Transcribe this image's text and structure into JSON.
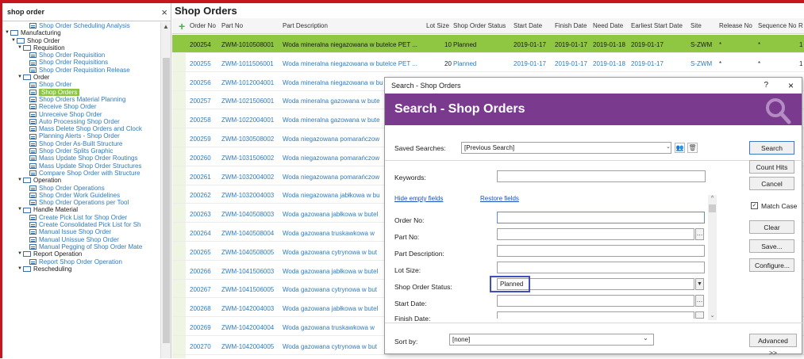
{
  "nav": {
    "search_value": "shop order",
    "tree": [
      {
        "label": "Shop Order Scheduling Analysis",
        "kind": "link",
        "indent": 3,
        "twisty": ""
      },
      {
        "label": "Manufacturing",
        "kind": "folder",
        "indent": 0,
        "twisty": "▼"
      },
      {
        "label": "Shop Order",
        "kind": "folder",
        "indent": 1,
        "twisty": "▼"
      },
      {
        "label": "Requisition",
        "kind": "folder",
        "indent": 2,
        "twisty": "▼"
      },
      {
        "label": "Shop Order Requisition",
        "kind": "link",
        "indent": 3,
        "twisty": ""
      },
      {
        "label": "Shop Order Requisitions",
        "kind": "link",
        "indent": 3,
        "twisty": ""
      },
      {
        "label": "Shop Order Requisition Release",
        "kind": "link",
        "indent": 3,
        "twisty": ""
      },
      {
        "label": "Order",
        "kind": "folder",
        "indent": 2,
        "twisty": "▼"
      },
      {
        "label": "Shop Order",
        "kind": "link",
        "indent": 3,
        "twisty": ""
      },
      {
        "label": "Shop Orders",
        "kind": "link",
        "indent": 3,
        "twisty": "",
        "selected": true
      },
      {
        "label": "Shop Orders Material Planning",
        "kind": "link",
        "indent": 3,
        "twisty": ""
      },
      {
        "label": "Receive Shop Order",
        "kind": "link",
        "indent": 3,
        "twisty": ""
      },
      {
        "label": "Unreceive Shop Order",
        "kind": "link",
        "indent": 3,
        "twisty": ""
      },
      {
        "label": "Auto Processing Shop Order",
        "kind": "link",
        "indent": 3,
        "twisty": ""
      },
      {
        "label": "Mass Delete Shop Orders and Clock",
        "kind": "link",
        "indent": 3,
        "twisty": ""
      },
      {
        "label": "Planning Alerts - Shop Order",
        "kind": "link",
        "indent": 3,
        "twisty": ""
      },
      {
        "label": "Shop Order As-Built Structure",
        "kind": "link",
        "indent": 3,
        "twisty": ""
      },
      {
        "label": "Shop Order Splits Graphic",
        "kind": "link",
        "indent": 3,
        "twisty": ""
      },
      {
        "label": "Mass Update Shop Order Routings",
        "kind": "link",
        "indent": 3,
        "twisty": ""
      },
      {
        "label": "Mass Update Shop Order Structures",
        "kind": "link",
        "indent": 3,
        "twisty": ""
      },
      {
        "label": "Compare Shop Order with Structure",
        "kind": "link",
        "indent": 3,
        "twisty": ""
      },
      {
        "label": "Operation",
        "kind": "folder",
        "indent": 2,
        "twisty": "▼"
      },
      {
        "label": "Shop Order Operations",
        "kind": "link",
        "indent": 3,
        "twisty": ""
      },
      {
        "label": "Shop Order Work Guidelines",
        "kind": "link",
        "indent": 3,
        "twisty": ""
      },
      {
        "label": "Shop Order Operations per Tool",
        "kind": "link",
        "indent": 3,
        "twisty": ""
      },
      {
        "label": "Handle Material",
        "kind": "folder",
        "indent": 2,
        "twisty": "▼"
      },
      {
        "label": "Create Pick List for Shop Order",
        "kind": "link",
        "indent": 3,
        "twisty": ""
      },
      {
        "label": "Create Consolidated Pick List for Sh",
        "kind": "link",
        "indent": 3,
        "twisty": ""
      },
      {
        "label": "Manual Issue Shop Order",
        "kind": "link",
        "indent": 3,
        "twisty": ""
      },
      {
        "label": "Manual Unissue Shop Order",
        "kind": "link",
        "indent": 3,
        "twisty": ""
      },
      {
        "label": "Manual Pegging of Shop Order Mate",
        "kind": "link",
        "indent": 3,
        "twisty": ""
      },
      {
        "label": "Report Operation",
        "kind": "folder",
        "indent": 2,
        "twisty": "▼"
      },
      {
        "label": "Report Shop Order Operation",
        "kind": "link",
        "indent": 3,
        "twisty": ""
      },
      {
        "label": "Rescheduling",
        "kind": "folder",
        "indent": 2,
        "twisty": "▼"
      }
    ]
  },
  "main": {
    "title": "Shop Orders",
    "columns": [
      "Order No",
      "Part No",
      "Part Description",
      "Lot Size",
      "Shop Order Status",
      "Start Date",
      "Finish Date",
      "Need Date",
      "Earliest Start Date",
      "Site",
      "Release No",
      "Sequence No",
      "R"
    ],
    "rows": [
      {
        "order": "200254",
        "part": "ZWM-1010508001",
        "desc": "Woda mineralna niegazowana w butelce PET ...",
        "lot": "10",
        "status": "Planned",
        "start": "2019-01-17",
        "finish": "2019-01-17",
        "need": "2019-01-18",
        "earliest": "2019-01-17",
        "site": "S-ZWM",
        "release": "*",
        "sequence": "*",
        "r": "1"
      },
      {
        "order": "200255",
        "part": "ZWM-1011506001",
        "desc": "Woda mineralna niegazowana w butelce PET ...",
        "lot": "20",
        "status": "Planned",
        "start": "2019-01-17",
        "finish": "2019-01-17",
        "need": "2019-01-18",
        "earliest": "2019-01-17",
        "site": "S-ZWM",
        "release": "*",
        "sequence": "*",
        "r": "1"
      },
      {
        "order": "200256",
        "part": "ZWM-1012004001",
        "desc": "Woda mineralna niegazowana w bu"
      },
      {
        "order": "200257",
        "part": "ZWM-1021506001",
        "desc": "Woda mineralna gazowana w bute"
      },
      {
        "order": "200258",
        "part": "ZWM-1022004001",
        "desc": "Woda mineralna gazowana w bute"
      },
      {
        "order": "200259",
        "part": "ZWM-1030508002",
        "desc": "Woda niegazowana pomarańczow"
      },
      {
        "order": "200260",
        "part": "ZWM-1031506002",
        "desc": "Woda niegazowana pomarańczow"
      },
      {
        "order": "200261",
        "part": "ZWM-1032004002",
        "desc": "Woda niegazowana pomarańczow"
      },
      {
        "order": "200262",
        "part": "ZWM-1032004003",
        "desc": "Woda niegazowana jabłkowa w bu"
      },
      {
        "order": "200263",
        "part": "ZWM-1040508003",
        "desc": "Woda gazowana jabłkowa w butel"
      },
      {
        "order": "200264",
        "part": "ZWM-1040508004",
        "desc": "Woda gazowana truskawkowa w"
      },
      {
        "order": "200265",
        "part": "ZWM-1040508005",
        "desc": "Woda gazowana cytrynowa w but"
      },
      {
        "order": "200266",
        "part": "ZWM-1041506003",
        "desc": "Woda gazowana jabłkowa w butel"
      },
      {
        "order": "200267",
        "part": "ZWM-1041506005",
        "desc": "Woda gazowana cytrynowa w but"
      },
      {
        "order": "200268",
        "part": "ZWM-1042004003",
        "desc": "Woda gazowana jabłkowa w butel"
      },
      {
        "order": "200269",
        "part": "ZWM-1042004004",
        "desc": "Woda gazowana truskawkowa w"
      },
      {
        "order": "200270",
        "part": "ZWM-1042004005",
        "desc": "Woda gazowana cytrynowa w but"
      }
    ]
  },
  "dialog": {
    "window_title": "Search - Shop Orders",
    "help": "?",
    "close": "×",
    "banner_title": "Search - Shop Orders",
    "saved_searches_label": "Saved Searches:",
    "saved_searches_value": "[Previous Search]",
    "keywords_label": "Keywords:",
    "hide_empty_fields": "Hide empty fields",
    "restore_fields": "Restore fields",
    "fields": [
      {
        "label": "Order No:",
        "value": ""
      },
      {
        "label": "Part No:",
        "value": ""
      },
      {
        "label": "Part Description:",
        "value": ""
      },
      {
        "label": "Lot Size:",
        "value": ""
      },
      {
        "label": "Shop Order Status:",
        "value": "Planned"
      },
      {
        "label": "Start Date:",
        "value": ""
      },
      {
        "label": "Finish Date:",
        "value": ""
      }
    ],
    "sort_by_label": "Sort by:",
    "sort_by_value": "[none]",
    "buttons": {
      "search": "Search",
      "count_hits": "Count Hits",
      "cancel": "Cancel",
      "match_case": "Match Case",
      "clear": "Clear",
      "save": "Save...",
      "configure": "Configure...",
      "advanced": "Advanced >>"
    },
    "match_case_checked": true
  },
  "colors": {
    "frame_red": "#c4161c",
    "selection_green": "#8fc743",
    "banner_purple": "#7a3b8f",
    "link_blue": "#2e7bbf",
    "highlight_blue": "#3e4fc0"
  }
}
